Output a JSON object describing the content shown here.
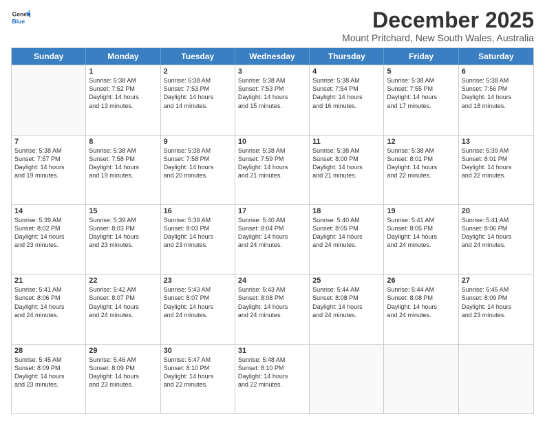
{
  "logo": {
    "general": "General",
    "blue": "Blue"
  },
  "title": "December 2025",
  "subtitle": "Mount Pritchard, New South Wales, Australia",
  "headers": [
    "Sunday",
    "Monday",
    "Tuesday",
    "Wednesday",
    "Thursday",
    "Friday",
    "Saturday"
  ],
  "weeks": [
    [
      {
        "day": "",
        "info": ""
      },
      {
        "day": "1",
        "info": "Sunrise: 5:38 AM\nSunset: 7:52 PM\nDaylight: 14 hours\nand 13 minutes."
      },
      {
        "day": "2",
        "info": "Sunrise: 5:38 AM\nSunset: 7:53 PM\nDaylight: 14 hours\nand 14 minutes."
      },
      {
        "day": "3",
        "info": "Sunrise: 5:38 AM\nSunset: 7:53 PM\nDaylight: 14 hours\nand 15 minutes."
      },
      {
        "day": "4",
        "info": "Sunrise: 5:38 AM\nSunset: 7:54 PM\nDaylight: 14 hours\nand 16 minutes."
      },
      {
        "day": "5",
        "info": "Sunrise: 5:38 AM\nSunset: 7:55 PM\nDaylight: 14 hours\nand 17 minutes."
      },
      {
        "day": "6",
        "info": "Sunrise: 5:38 AM\nSunset: 7:56 PM\nDaylight: 14 hours\nand 18 minutes."
      }
    ],
    [
      {
        "day": "7",
        "info": "Sunrise: 5:38 AM\nSunset: 7:57 PM\nDaylight: 14 hours\nand 19 minutes."
      },
      {
        "day": "8",
        "info": "Sunrise: 5:38 AM\nSunset: 7:58 PM\nDaylight: 14 hours\nand 19 minutes."
      },
      {
        "day": "9",
        "info": "Sunrise: 5:38 AM\nSunset: 7:58 PM\nDaylight: 14 hours\nand 20 minutes."
      },
      {
        "day": "10",
        "info": "Sunrise: 5:38 AM\nSunset: 7:59 PM\nDaylight: 14 hours\nand 21 minutes."
      },
      {
        "day": "11",
        "info": "Sunrise: 5:38 AM\nSunset: 8:00 PM\nDaylight: 14 hours\nand 21 minutes."
      },
      {
        "day": "12",
        "info": "Sunrise: 5:38 AM\nSunset: 8:01 PM\nDaylight: 14 hours\nand 22 minutes."
      },
      {
        "day": "13",
        "info": "Sunrise: 5:39 AM\nSunset: 8:01 PM\nDaylight: 14 hours\nand 22 minutes."
      }
    ],
    [
      {
        "day": "14",
        "info": "Sunrise: 5:39 AM\nSunset: 8:02 PM\nDaylight: 14 hours\nand 23 minutes."
      },
      {
        "day": "15",
        "info": "Sunrise: 5:39 AM\nSunset: 8:03 PM\nDaylight: 14 hours\nand 23 minutes."
      },
      {
        "day": "16",
        "info": "Sunrise: 5:39 AM\nSunset: 8:03 PM\nDaylight: 14 hours\nand 23 minutes."
      },
      {
        "day": "17",
        "info": "Sunrise: 5:40 AM\nSunset: 8:04 PM\nDaylight: 14 hours\nand 24 minutes."
      },
      {
        "day": "18",
        "info": "Sunrise: 5:40 AM\nSunset: 8:05 PM\nDaylight: 14 hours\nand 24 minutes."
      },
      {
        "day": "19",
        "info": "Sunrise: 5:41 AM\nSunset: 8:05 PM\nDaylight: 14 hours\nand 24 minutes."
      },
      {
        "day": "20",
        "info": "Sunrise: 5:41 AM\nSunset: 8:06 PM\nDaylight: 14 hours\nand 24 minutes."
      }
    ],
    [
      {
        "day": "21",
        "info": "Sunrise: 5:41 AM\nSunset: 8:06 PM\nDaylight: 14 hours\nand 24 minutes."
      },
      {
        "day": "22",
        "info": "Sunrise: 5:42 AM\nSunset: 8:07 PM\nDaylight: 14 hours\nand 24 minutes."
      },
      {
        "day": "23",
        "info": "Sunrise: 5:43 AM\nSunset: 8:07 PM\nDaylight: 14 hours\nand 24 minutes."
      },
      {
        "day": "24",
        "info": "Sunrise: 5:43 AM\nSunset: 8:08 PM\nDaylight: 14 hours\nand 24 minutes."
      },
      {
        "day": "25",
        "info": "Sunrise: 5:44 AM\nSunset: 8:08 PM\nDaylight: 14 hours\nand 24 minutes."
      },
      {
        "day": "26",
        "info": "Sunrise: 5:44 AM\nSunset: 8:08 PM\nDaylight: 14 hours\nand 24 minutes."
      },
      {
        "day": "27",
        "info": "Sunrise: 5:45 AM\nSunset: 8:09 PM\nDaylight: 14 hours\nand 23 minutes."
      }
    ],
    [
      {
        "day": "28",
        "info": "Sunrise: 5:45 AM\nSunset: 8:09 PM\nDaylight: 14 hours\nand 23 minutes."
      },
      {
        "day": "29",
        "info": "Sunrise: 5:46 AM\nSunset: 8:09 PM\nDaylight: 14 hours\nand 23 minutes."
      },
      {
        "day": "30",
        "info": "Sunrise: 5:47 AM\nSunset: 8:10 PM\nDaylight: 14 hours\nand 22 minutes."
      },
      {
        "day": "31",
        "info": "Sunrise: 5:48 AM\nSunset: 8:10 PM\nDaylight: 14 hours\nand 22 minutes."
      },
      {
        "day": "",
        "info": ""
      },
      {
        "day": "",
        "info": ""
      },
      {
        "day": "",
        "info": ""
      }
    ]
  ]
}
